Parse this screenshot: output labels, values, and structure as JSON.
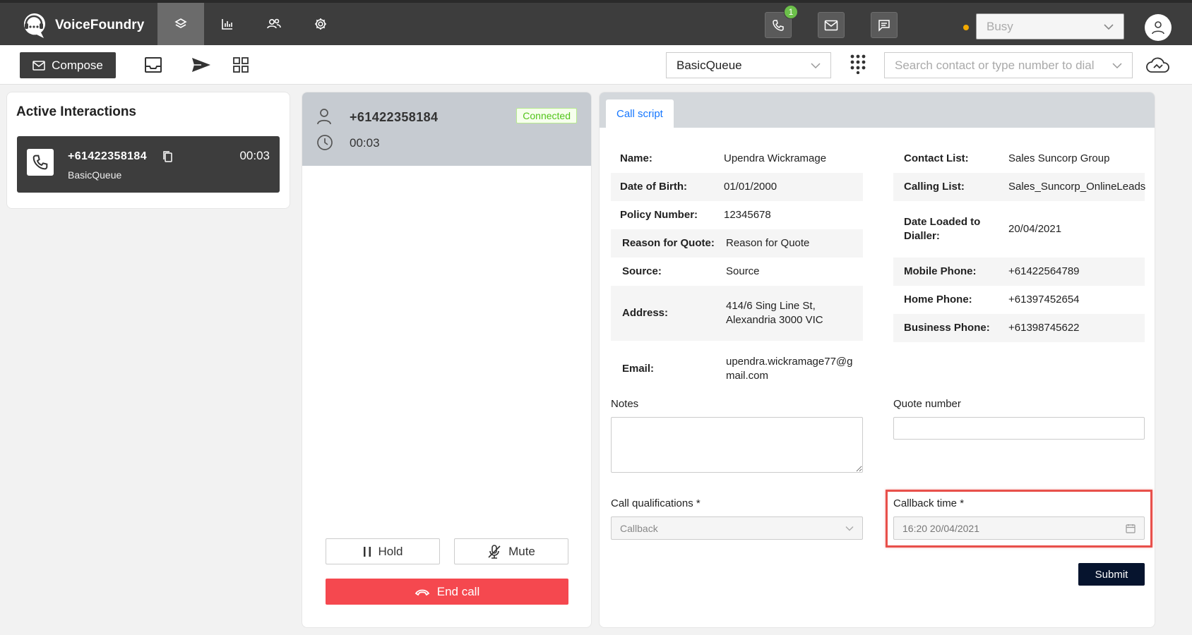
{
  "app": {
    "name": "VoiceFoundry",
    "logo_icon": "speech-bubble-headset-icon"
  },
  "topbar": {
    "nav": [
      {
        "id": "workspace",
        "icon": "layers-icon",
        "active": true
      },
      {
        "id": "reports",
        "icon": "bar-chart-icon",
        "active": false
      },
      {
        "id": "contacts",
        "icon": "users-icon",
        "active": false
      },
      {
        "id": "settings",
        "icon": "gear-icon",
        "active": false
      }
    ],
    "channels": {
      "voice_badge": "1",
      "voice_icon": "phone-icon",
      "email_icon": "mail-icon",
      "chat_icon": "chat-icon"
    },
    "status": {
      "value": "Busy",
      "dot_color": "#f2a900"
    },
    "avatar_icon": "user-icon"
  },
  "subbar": {
    "compose_label": "Compose",
    "queue_select": "BasicQueue",
    "search_placeholder": "Search contact or type number to dial"
  },
  "active_interactions": {
    "title": "Active Interactions",
    "items": [
      {
        "number": "+61422358184",
        "queue": "BasicQueue",
        "timer": "00:03"
      }
    ]
  },
  "call": {
    "number": "+61422358184",
    "duration": "00:03",
    "status": "Connected",
    "hold_label": "Hold",
    "mute_label": "Mute",
    "end_label": "End call"
  },
  "script": {
    "tab_label": "Call script",
    "left_fields": [
      {
        "label": "Name:",
        "value": "Upendra Wickramage"
      },
      {
        "label": "Date of Birth:",
        "value": "01/01/2000"
      },
      {
        "label": "Policy Number:",
        "value": "12345678"
      },
      {
        "label": "Reason for Quote:",
        "value": "Reason for Quote"
      },
      {
        "label": "Source:",
        "value": "Source"
      },
      {
        "label": "Address:",
        "value": "414/6 Sing Line St, Alexandria 3000 VIC"
      },
      {
        "label": "Email:",
        "value": "upendra.wickramage77@gmail.com"
      }
    ],
    "right_fields": [
      {
        "label": "Contact List:",
        "value": "Sales Suncorp Group"
      },
      {
        "label": "Calling List:",
        "value": "Sales_Suncorp_OnlineLeads"
      },
      {
        "label": "Date Loaded to Dialler:",
        "value": "20/04/2021"
      },
      {
        "label": "Mobile Phone:",
        "value": "+61422564789"
      },
      {
        "label": "Home Phone:",
        "value": "+61397452654"
      },
      {
        "label": "Business Phone:",
        "value": "+61398745622"
      }
    ],
    "notes_label": "Notes",
    "quote_label": "Quote number",
    "qualifications_label": "Call qualifications *",
    "qualifications_value": "Callback",
    "callback_label": "Callback time *",
    "callback_value": "16:20 20/04/2021",
    "submit_label": "Submit"
  }
}
